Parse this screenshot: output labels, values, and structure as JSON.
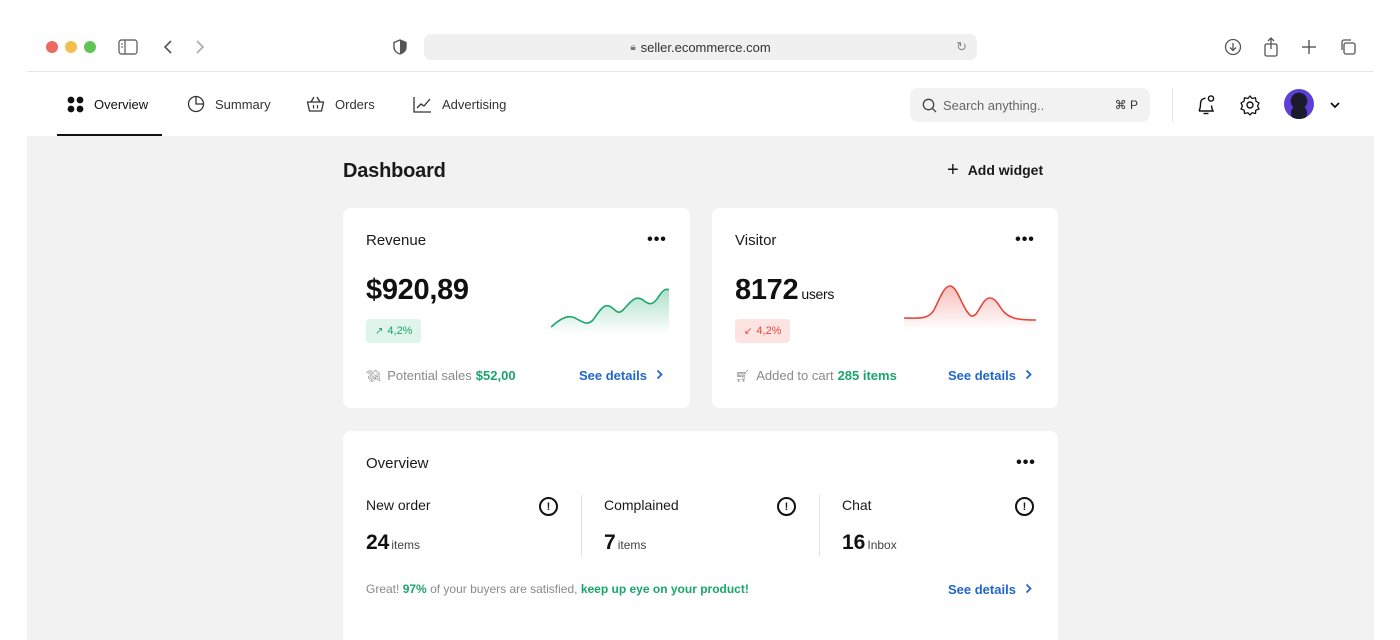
{
  "browser": {
    "url": "seller.ecommerce.com"
  },
  "nav": {
    "items": [
      {
        "label": "Overview",
        "icon": "grid-icon",
        "active": true
      },
      {
        "label": "Summary",
        "icon": "pie-chart-icon"
      },
      {
        "label": "Orders",
        "icon": "basket-icon"
      },
      {
        "label": "Advertising",
        "icon": "line-chart-icon"
      }
    ],
    "search": {
      "placeholder": "Search anything..",
      "shortcut": "⌘ P"
    }
  },
  "main": {
    "title": "Dashboard",
    "add_widget_label": "Add widget"
  },
  "revenue_card": {
    "title": "Revenue",
    "value": "$920,89",
    "change": "4,2%",
    "change_direction": "up",
    "footnote_label": "Potential sales",
    "footnote_value": "$52,00",
    "details_label": "See details",
    "accent": "#1aa66a"
  },
  "visitor_card": {
    "title": "Visitor",
    "value": "8172",
    "unit": "users",
    "change": "4,2%",
    "change_direction": "down",
    "footnote_label": "Added to cart",
    "footnote_value": "285 items",
    "details_label": "See details",
    "accent": "#e5483b"
  },
  "overview_card": {
    "title": "Overview",
    "stats": [
      {
        "label": "New order",
        "value": "24",
        "unit": "items"
      },
      {
        "label": "Complained",
        "value": "7",
        "unit": "items"
      },
      {
        "label": "Chat",
        "value": "16",
        "unit": "Inbox"
      }
    ],
    "footer": {
      "prefix": "Great!",
      "percent": "97%",
      "middle": "of your buyers are satisfied,",
      "cta": "keep up eye on your product!"
    },
    "details_label": "See details"
  }
}
